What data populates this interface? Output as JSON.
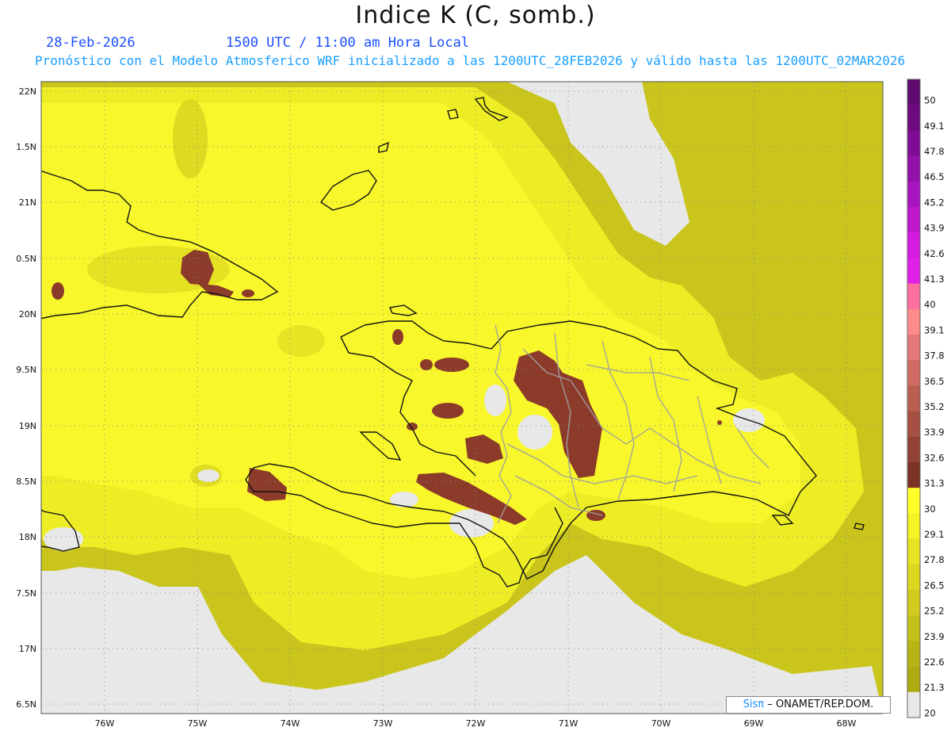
{
  "title": "Indice K (C, somb.)",
  "date": "28-Feb-2026",
  "valid_time": "1500 UTC / 11:00 am Hora Local",
  "forecast_line": "Pronóstico con el Modelo Atmosferico WRF inicializado a las 1200UTC_28FEB2026 y válido hasta las  1200UTC_02MAR2026",
  "lat_labels": [
    "22N",
    "1.5N",
    "21N",
    "0.5N",
    "20N",
    "9.5N",
    "19N",
    "8.5N",
    "18N",
    "7.5N",
    "17N",
    "6.5N"
  ],
  "lon_labels": [
    "76W",
    "75W",
    "74W",
    "73W",
    "72W",
    "71W",
    "70W",
    "69W",
    "68W"
  ],
  "colorbar": {
    "levels": [
      "50",
      "49.1",
      "47.8",
      "46.5",
      "45.2",
      "43.9",
      "42.6",
      "41.3",
      "40",
      "39.1",
      "37.8",
      "36.5",
      "35.2",
      "33.9",
      "32.6",
      "31.3",
      "30",
      "29.1",
      "27.8",
      "26.5",
      "25.2",
      "23.9",
      "22.6",
      "21.3",
      "20"
    ],
    "colors": [
      "#5e0a6e",
      "#6e0a80",
      "#800c95",
      "#9410aa",
      "#a814bf",
      "#bf18cf",
      "#d41cdf",
      "#e020e6",
      "#ff6fa0",
      "#ff8a8a",
      "#e47878",
      "#cf6b62",
      "#bb5e52",
      "#a65043",
      "#914235",
      "#7c3326",
      "#ffff2a",
      "#f3f326",
      "#e6e422",
      "#dbd71f",
      "#d0cb1c",
      "#c4c019",
      "#b9b416",
      "#afab13",
      "#e8e8e8"
    ]
  },
  "credit": {
    "sis": "Sisπ",
    "rest": "– ONAMET/REP.DOM."
  },
  "colors": {
    "land_yellow": "#f2f22a",
    "dark_yellow": "#c8c41b",
    "brown": "#8c3a2a",
    "no_data": "#e8e8e8"
  }
}
